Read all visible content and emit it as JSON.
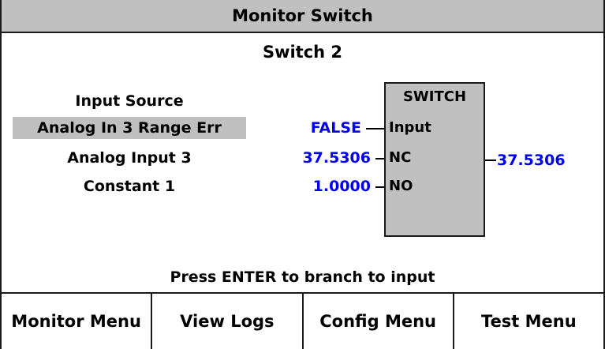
{
  "window": {
    "title": "Monitor Switch"
  },
  "block": {
    "name": "Switch 2",
    "type_label": "SWITCH"
  },
  "inputs": [
    {
      "label": "Input Source",
      "selected": false
    },
    {
      "label": "Analog In 3 Range Err",
      "selected": true
    },
    {
      "label": "Analog Input 3",
      "selected": false
    },
    {
      "label": "Constant 1",
      "selected": false
    }
  ],
  "ports": [
    {
      "name": "Input",
      "value": "FALSE"
    },
    {
      "name": "NC",
      "value": "37.5306"
    },
    {
      "name": "NO",
      "value": "1.0000"
    }
  ],
  "output": {
    "value": "37.5306"
  },
  "hint": "Press ENTER to branch to input",
  "menu": [
    {
      "label": "Monitor Menu"
    },
    {
      "label": "View Logs"
    },
    {
      "label": "Config Menu"
    },
    {
      "label": "Test Menu"
    }
  ],
  "colors": {
    "value_text": "#0000ee",
    "selection_bg": "#c0c0c0",
    "block_bg": "#c0c0c0"
  }
}
